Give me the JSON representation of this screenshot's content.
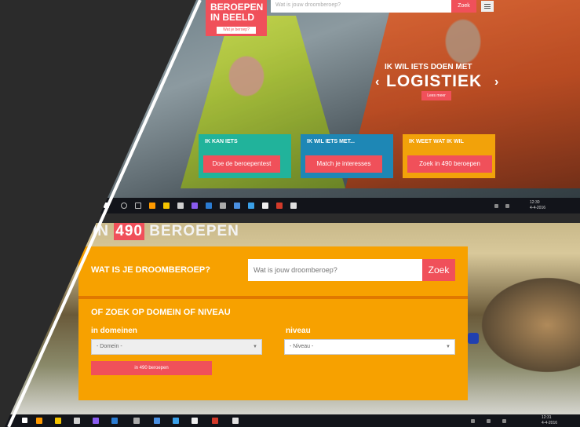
{
  "top": {
    "brand": {
      "line1": "BEROEPEN",
      "line2": "IN BEELD",
      "button": "Wat je beroep?"
    },
    "search_placeholder": "Wat is jouw droomberoep?",
    "zoek_label": "Zoek",
    "hero": {
      "small": "IK WIL IETS DOEN MET",
      "big": "LOGISTIEK",
      "prev": "‹",
      "next": "›",
      "button": "Lees meer"
    },
    "cta": [
      {
        "title": "IK KAN IETS",
        "button": "Doe de beroepentest"
      },
      {
        "title": "IK WIL IETS MET...",
        "button": "Match je interesses"
      },
      {
        "title": "IK WEET WAT IK WIL",
        "button": "Zoek in 490 beroepen"
      }
    ],
    "taskbar_time": "12:30",
    "taskbar_date": "4-4-2016"
  },
  "bottom": {
    "heading_prefix": "IN",
    "heading_number": "490",
    "heading_suffix": "BEROEPEN",
    "question": "WAT IS JE DROOMBEROEP?",
    "search_placeholder": "Wat is jouw droomberoep?",
    "zoek_label": "Zoek",
    "or_label": "OF ZOEK OP DOMEIN OF NIVEAU",
    "domeinen_label": "in domeinen",
    "niveau_label": "niveau",
    "domeinen_selected": "- Domein -",
    "niveau_selected": "- Niveau -",
    "search_button": "in 490 beroepen",
    "taskbar_time": "12:31",
    "taskbar_date": "4-4-2016"
  },
  "colors": {
    "coral": "#f0505a",
    "orange": "#f7a100",
    "teal": "#21b39b",
    "blue": "#1e87b5",
    "amber": "#f2a20a",
    "dark": "#2b2b2b"
  }
}
